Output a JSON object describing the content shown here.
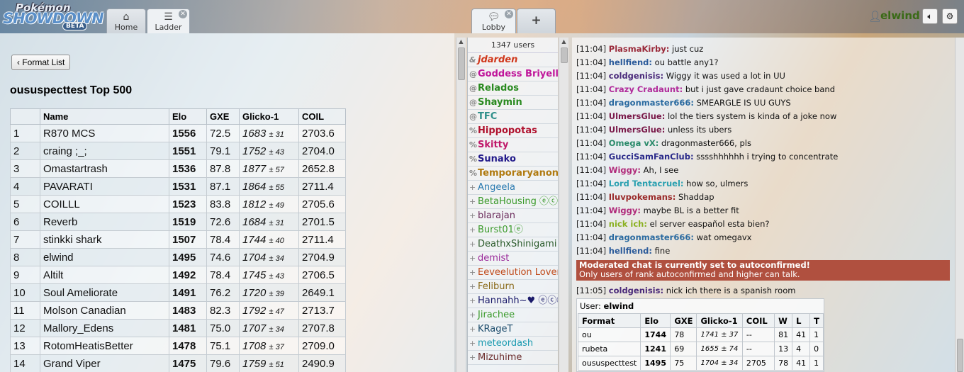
{
  "app": {
    "logo_line1": "Pokémon",
    "logo_line2": "SHOWDOWN",
    "logo_badge": "BETA"
  },
  "tabs": [
    {
      "label": "Home",
      "icon": "home-icon"
    },
    {
      "label": "Ladder",
      "icon": "list-icon",
      "closable": true
    },
    {
      "label": "Lobby",
      "icon": "chat-bubble-icon",
      "closable": true
    },
    {
      "label": "+",
      "icon": "plus-icon"
    }
  ],
  "header": {
    "username": "elwind",
    "username_color": "#3a6a17"
  },
  "ladder": {
    "back_label": "Format List",
    "title": "oususpecttest Top 500",
    "columns": [
      "",
      "Name",
      "Elo",
      "GXE",
      "Glicko-1",
      "COIL"
    ],
    "rows": [
      {
        "rank": "1",
        "name": "R870 MCS",
        "elo": "1556",
        "gxe": "72.5",
        "glicko": "1683",
        "dev": "± 31",
        "coil": "2703.6"
      },
      {
        "rank": "2",
        "name": "craing ;_;",
        "elo": "1551",
        "gxe": "79.1",
        "glicko": "1752",
        "dev": "± 43",
        "coil": "2704.0"
      },
      {
        "rank": "3",
        "name": "Omastartrash",
        "elo": "1536",
        "gxe": "87.8",
        "glicko": "1877",
        "dev": "± 57",
        "coil": "2652.8"
      },
      {
        "rank": "4",
        "name": "PAVARATI",
        "elo": "1531",
        "gxe": "87.1",
        "glicko": "1864",
        "dev": "± 55",
        "coil": "2711.4"
      },
      {
        "rank": "5",
        "name": "COILLL",
        "elo": "1523",
        "gxe": "83.8",
        "glicko": "1812",
        "dev": "± 49",
        "coil": "2705.6"
      },
      {
        "rank": "6",
        "name": "Reverb",
        "elo": "1519",
        "gxe": "72.6",
        "glicko": "1684",
        "dev": "± 31",
        "coil": "2701.5"
      },
      {
        "rank": "7",
        "name": "stinkki shark",
        "elo": "1507",
        "gxe": "78.4",
        "glicko": "1744",
        "dev": "± 40",
        "coil": "2711.4"
      },
      {
        "rank": "8",
        "name": "elwind",
        "elo": "1495",
        "gxe": "74.6",
        "glicko": "1704",
        "dev": "± 34",
        "coil": "2704.9"
      },
      {
        "rank": "9",
        "name": "Altilt",
        "elo": "1492",
        "gxe": "78.4",
        "glicko": "1745",
        "dev": "± 43",
        "coil": "2706.5"
      },
      {
        "rank": "10",
        "name": "Soul Ameliorate",
        "elo": "1491",
        "gxe": "76.2",
        "glicko": "1720",
        "dev": "± 39",
        "coil": "2649.1"
      },
      {
        "rank": "11",
        "name": "Molson Canadian",
        "elo": "1483",
        "gxe": "82.3",
        "glicko": "1792",
        "dev": "± 47",
        "coil": "2713.7"
      },
      {
        "rank": "12",
        "name": "Mallory_Edens",
        "elo": "1481",
        "gxe": "75.0",
        "glicko": "1707",
        "dev": "± 34",
        "coil": "2707.8"
      },
      {
        "rank": "13",
        "name": "RotomHeatisBetter",
        "elo": "1478",
        "gxe": "75.1",
        "glicko": "1708",
        "dev": "± 37",
        "coil": "2709.0"
      },
      {
        "rank": "14",
        "name": "Grand Viper",
        "elo": "1475",
        "gxe": "79.6",
        "glicko": "1759",
        "dev": "± 51",
        "coil": "2490.9"
      }
    ]
  },
  "userlist": {
    "count": "1347 users",
    "users": [
      {
        "group": "&",
        "name": "jdarden",
        "color": "#d0381c",
        "bold": true,
        "italic": true
      },
      {
        "group": "@",
        "name": "Goddess Briyella",
        "color": "#c0169a",
        "bold": true
      },
      {
        "group": "@",
        "name": "Relados",
        "color": "#2a8a20",
        "bold": true
      },
      {
        "group": "@",
        "name": "Shaymin",
        "color": "#2a8a20",
        "bold": true
      },
      {
        "group": "@",
        "name": "TFC",
        "color": "#2f8f8a",
        "bold": true
      },
      {
        "group": "%",
        "name": "Hippopotas",
        "color": "#b0122e",
        "bold": true
      },
      {
        "group": "%",
        "name": "Skitty",
        "color": "#c01a6a",
        "bold": true
      },
      {
        "group": "%",
        "name": "Sunako",
        "color": "#221a8a",
        "bold": true
      },
      {
        "group": "%",
        "name": "Temporaryanony",
        "color": "#b07a10",
        "bold": true
      },
      {
        "group": "+",
        "name": "Angeela",
        "color": "#2a7ab0"
      },
      {
        "group": "+",
        "name": "BetaHousing ⓔⓒⓒ",
        "color": "#3a9a2a"
      },
      {
        "group": "+",
        "name": "blarajan",
        "color": "#6a2a5a"
      },
      {
        "group": "+",
        "name": "Burst01ⓔ",
        "color": "#3a9a2a"
      },
      {
        "group": "+",
        "name": "DeathxShinigami",
        "color": "#2a5a2a"
      },
      {
        "group": "+",
        "name": "demist",
        "color": "#9a2a9a"
      },
      {
        "group": "+",
        "name": "Eeveelution Lover",
        "color": "#c04a1a"
      },
      {
        "group": "+",
        "name": "Feliburn",
        "color": "#8a6a1a"
      },
      {
        "group": "+",
        "name": "Hannahh~♥ ⓔⓒⓒ",
        "color": "#1a1a6a"
      },
      {
        "group": "+",
        "name": "Jirachee",
        "color": "#3a9a2a"
      },
      {
        "group": "+",
        "name": "KRageT",
        "color": "#1a4a6a"
      },
      {
        "group": "+",
        "name": "meteordash",
        "color": "#1a9ab0"
      },
      {
        "group": "+",
        "name": "Mizuhime",
        "color": "#6a2a2a"
      }
    ]
  },
  "chat": {
    "messages": [
      {
        "time": "[11:04]",
        "author": "PlasmaKirby:",
        "color": "#9a2a3a",
        "text": "just cuz"
      },
      {
        "time": "[11:04]",
        "author": "hellfiend:",
        "color": "#2a5a9a",
        "text": "ou battle any1?"
      },
      {
        "time": "[11:04]",
        "author": "coldgenisis:",
        "color": "#4a2a7a",
        "text": "Wiggy it was used a lot in UU"
      },
      {
        "time": "[11:04]",
        "author": "Crazy Cradaunt:",
        "color": "#b02a9a",
        "text": "but i just gave cradaunt choice band"
      },
      {
        "time": "[11:04]",
        "author": "dragonmaster666:",
        "color": "#2a6aa0",
        "text": "SMEARGLE IS UU GUYS"
      },
      {
        "time": "[11:04]",
        "author": "UlmersGlue:",
        "color": "#7a1a4a",
        "text": "lol the tiers system is kinda of a joke now"
      },
      {
        "time": "[11:04]",
        "author": "UlmersGlue:",
        "color": "#7a1a4a",
        "text": "unless its ubers"
      },
      {
        "time": "[11:04]",
        "author": "Omega vX:",
        "color": "#2a8a6a",
        "text": "dragonmaster666, pls"
      },
      {
        "time": "[11:04]",
        "author": "GucciSamFanClub:",
        "color": "#2a2a8a",
        "text": "sssshhhhhh i trying to concentrate"
      },
      {
        "time": "[11:04]",
        "author": "Wiggy:",
        "color": "#b02a7a",
        "text": "Ah, I see"
      },
      {
        "time": "[11:04]",
        "author": "Lord Tentacruel:",
        "color": "#2aa0b0",
        "text": "how so, ulmers"
      },
      {
        "time": "[11:04]",
        "author": "Iluvpokemans:",
        "color": "#9a2a2a",
        "text": "Shaddap"
      },
      {
        "time": "[11:04]",
        "author": "Wiggy:",
        "color": "#b02a7a",
        "text": "maybe BL is a better fit"
      },
      {
        "time": "[11:04]",
        "author": "nick ich:",
        "color": "#8ab020",
        "text": "el server easpañol esta bien?"
      },
      {
        "time": "[11:04]",
        "author": "dragonmaster666:",
        "color": "#2a6aa0",
        "text": "wat omegavx"
      },
      {
        "time": "[11:04]",
        "author": "hellfiend:",
        "color": "#2a5a9a",
        "text": "fine"
      }
    ],
    "notice_line1": "Moderated chat is currently set to autoconfirmed!",
    "notice_line2": "Only users of rank autoconfirmed and higher can talk.",
    "after_notice": {
      "time": "[11:05]",
      "author": "coldgenisis:",
      "color": "#4a2a7a",
      "text": "nick ich there is a spanish room"
    },
    "rank": {
      "user_label": "User:",
      "user_name": "elwind",
      "columns": [
        "Format",
        "Elo",
        "GXE",
        "Glicko-1",
        "COIL",
        "W",
        "L",
        "T"
      ],
      "rows": [
        {
          "format": "ou",
          "elo": "1744",
          "gxe": "78",
          "glicko": "1741 ± 37",
          "coil": "--",
          "w": "81",
          "l": "41",
          "t": "1"
        },
        {
          "format": "rubeta",
          "elo": "1241",
          "gxe": "69",
          "glicko": "1655 ± 74",
          "coil": "--",
          "w": "13",
          "l": "4",
          "t": "0"
        },
        {
          "format": "oususpecttest",
          "elo": "1495",
          "gxe": "75",
          "glicko": "1704 ± 34",
          "coil": "2705",
          "w": "78",
          "l": "41",
          "t": "1"
        }
      ]
    }
  }
}
